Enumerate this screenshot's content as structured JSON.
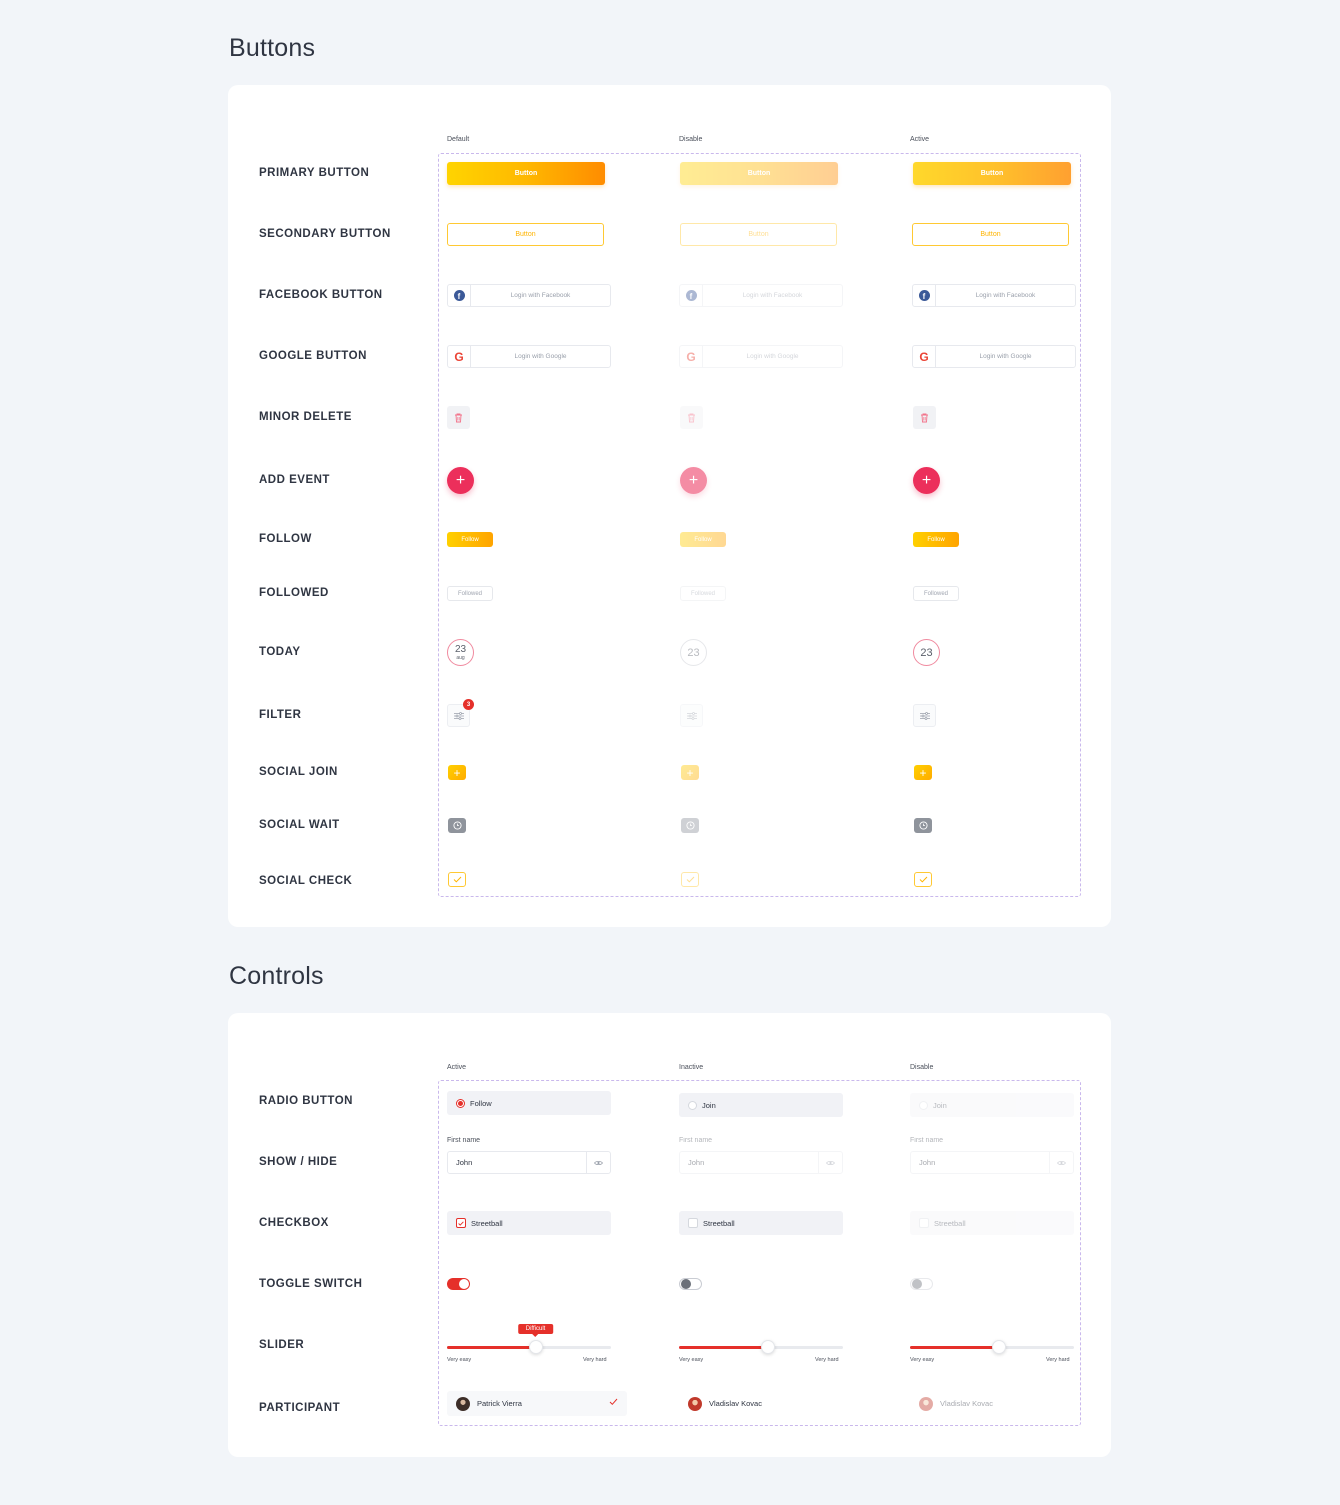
{
  "buttons_section": {
    "title": "Buttons",
    "columns": [
      "Default",
      "Disable",
      "Active"
    ],
    "rows": {
      "primary": "PRIMARY BUTTON",
      "secondary": "SECONDARY BUTTON",
      "facebook": "FACEBOOK BUTTON",
      "google": "GOOGLE BUTTON",
      "minor_delete": "MINOR DELETE",
      "add_event": "ADD EVENT",
      "follow": "FOLLOW",
      "followed": "FOLLOWED",
      "today": "TODAY",
      "filter": "FILTER",
      "social_join": "SOCIAL JOIN",
      "social_wait": "SOCIAL WAIT",
      "social_check": "SOCIAL CHECK"
    },
    "labels": {
      "button": "Button",
      "facebook": "Login with Facebook",
      "google": "Login with Google",
      "follow": "Follow",
      "followed": "Followed",
      "today_day": "23",
      "today_month": "aug",
      "filter_count": "3"
    }
  },
  "controls_section": {
    "title": "Controls",
    "columns": [
      "Active",
      "Inactive",
      "Disable"
    ],
    "rows": {
      "radio": "RADIO BUTTON",
      "show_hide": "SHOW / HIDE",
      "checkbox": "CHECKBOX",
      "toggle": "TOGGLE SWITCH",
      "slider": "SLIDER",
      "participant": "PARTICIPANT"
    },
    "radio_labels": [
      "Follow",
      "Join",
      "Join"
    ],
    "field_label": "First name",
    "field_value": "John",
    "checkbox_label": "Streetball",
    "slider": {
      "tooltip": "Difficult",
      "min_label": "Very easy",
      "max_label": "Very hard",
      "values": [
        0.54,
        0.54,
        0.54
      ]
    },
    "participants": [
      "Patrick Vierra",
      "Vladislav Kovac",
      "Vladislav Kovac"
    ]
  },
  "colors": {
    "accent_red": "#e5302a",
    "primary_yellow": "#ffc400",
    "add_event_pink": "#ec2f5b",
    "facebook_blue": "#3b5998",
    "google_red": "#ea4335"
  }
}
